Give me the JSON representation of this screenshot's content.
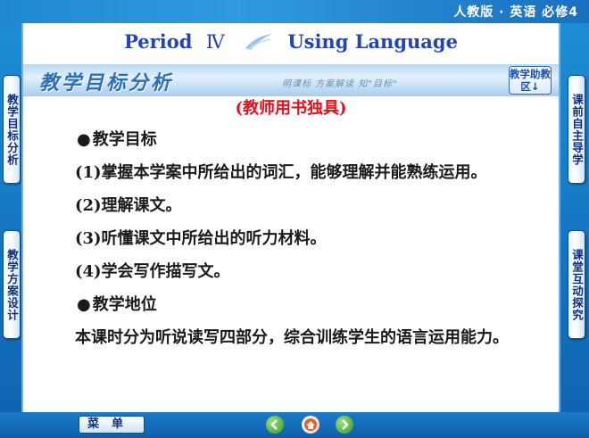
{
  "header": {
    "edition": "人教版 · 英语  必修4"
  },
  "title": {
    "prefix": "Period",
    "roman": "Ⅳ",
    "main": "Using Language"
  },
  "band": {
    "title": "教学目标分析",
    "subtitle": "明课标  方案解读  知\"目标\"",
    "help_button": "教学助教区↓"
  },
  "note": "(教师用书独具)",
  "content": {
    "goals_heading": "教学目标",
    "items": [
      "(1)掌握本学案中所给出的词汇，能够理解并能熟练运用。",
      "(2)理解课文。",
      "(3)听懂课文中所给出的听力材料。",
      "(4)学会写作描写文。"
    ],
    "position_heading": "教学地位",
    "position_text": "本课时分为听说读写四部分，综合训练学生的语言运用能力。"
  },
  "side_tabs": {
    "left_top": "教学目标分析",
    "left_bottom": "教学方案设计",
    "right_top": "课前自主导学",
    "right_bottom": "课堂互动探究"
  },
  "bottom": {
    "menu_label": "菜单"
  },
  "colors": {
    "title": "#2244b8",
    "note": "#e0101e",
    "frame": "#1678c4"
  }
}
